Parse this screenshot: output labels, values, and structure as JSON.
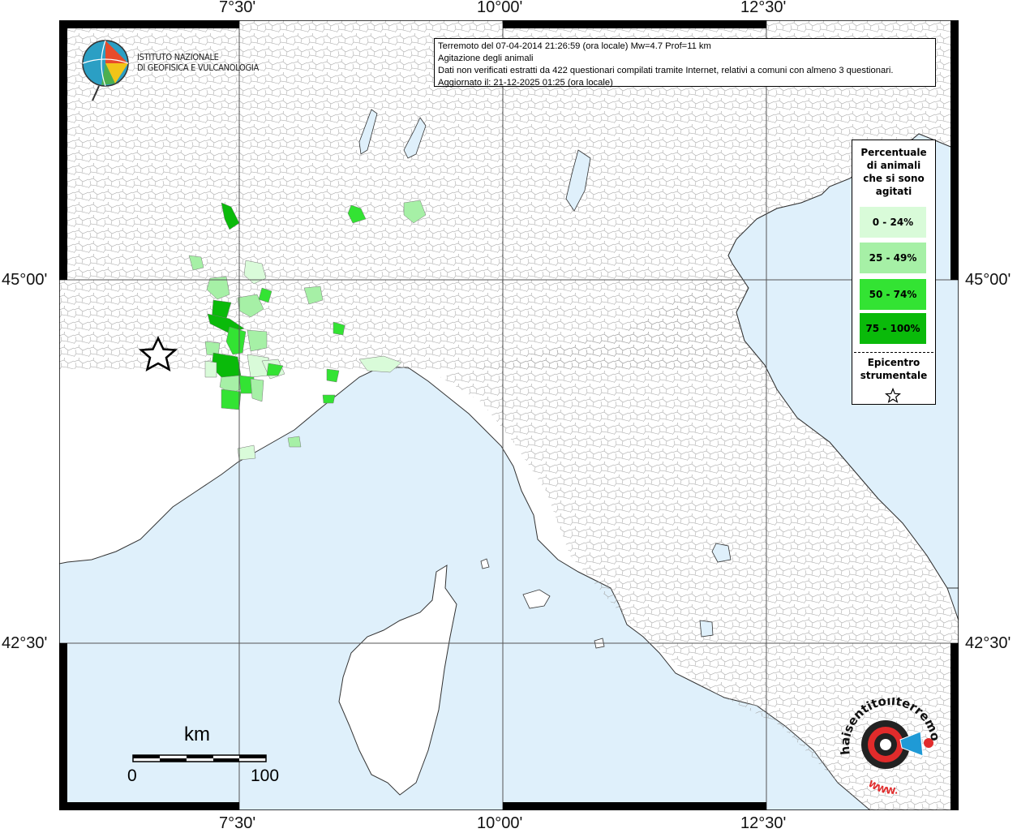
{
  "axes": {
    "top_ticks": [
      "7°30'",
      "10°00'",
      "12°30'"
    ],
    "bottom_ticks": [
      "7°30'",
      "10°00'",
      "12°30'"
    ],
    "left_ticks": [
      "45°00'",
      "42°30'"
    ],
    "right_ticks": [
      "45°00'",
      "42°30'"
    ]
  },
  "logo": {
    "line1": "ISTITUTO NAZIONALE",
    "line2": "DI GEOFISICA E VULCANOLOGIA"
  },
  "info": {
    "line1": "Terremoto del 07-04-2014 21:26:59 (ora locale) Mw=4.7 Prof=11 km",
    "line2": "Agitazione degli animali",
    "line3": "Dati non verificati estratti da 422 questionari compilati tramite Internet, relativi a comuni con almeno 3 questionari.",
    "line4": "Aggiornato il: 21-12-2025 01:25 (ora locale)"
  },
  "legend": {
    "title": [
      "Percentuale",
      "di animali",
      "che si sono",
      "agitati"
    ],
    "items": [
      {
        "label": "0 - 24%",
        "color": "#d9fbd9"
      },
      {
        "label": "25 - 49%",
        "color": "#a6f0a6"
      },
      {
        "label": "50 - 74%",
        "color": "#33e333"
      },
      {
        "label": "75 - 100%",
        "color": "#0aba0a"
      }
    ],
    "epicenter_label": [
      "Epicentro",
      "strumentale"
    ]
  },
  "scale": {
    "title": "km",
    "min_label": "0",
    "max_label": "100"
  },
  "badge": {
    "text_top": "haisentitoilterremoto.it",
    "text_bottom": "WWW."
  },
  "colors": {
    "sea": "#dff0fb",
    "land": "#ffffff",
    "boundary": "#9a9a9a",
    "grid": "#555555"
  }
}
